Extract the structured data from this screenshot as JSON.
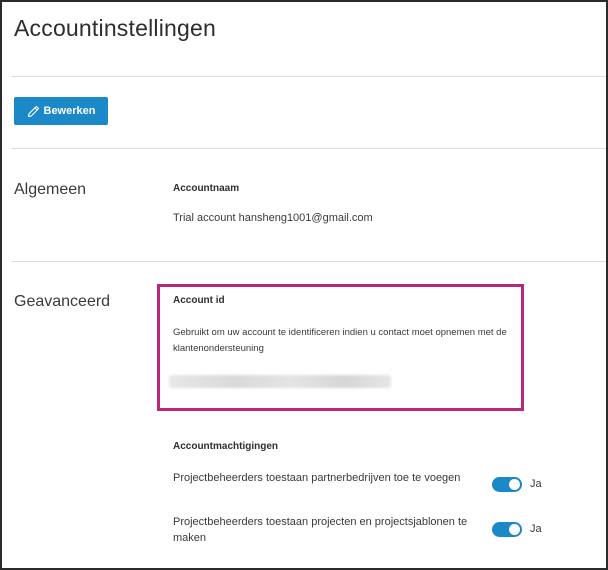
{
  "page": {
    "title": "Accountinstellingen"
  },
  "toolbar": {
    "edit_label": "Bewerken",
    "edit_icon": "pencil-icon"
  },
  "general": {
    "section_label": "Algemeen",
    "account_name_label": "Accountnaam",
    "account_name_value": "Trial account hansheng1001@gmail.com"
  },
  "advanced": {
    "section_label": "Geavanceerd",
    "account_id_label": "Account id",
    "account_id_description": "Gebruikt om uw account te identificeren indien u contact moet opnemen met de klantenondersteuning",
    "highlight_color": "#b8287a"
  },
  "permissions": {
    "heading": "Accountmachtigingen",
    "items": [
      {
        "text": "Projectbeheerders toestaan partnerbedrijven toe te voegen",
        "enabled": true,
        "state_label": "Ja"
      },
      {
        "text": "Projectbeheerders toestaan projecten en projectsjablonen te maken",
        "enabled": true,
        "state_label": "Ja"
      }
    ]
  },
  "colors": {
    "accent": "#1b88c8"
  }
}
